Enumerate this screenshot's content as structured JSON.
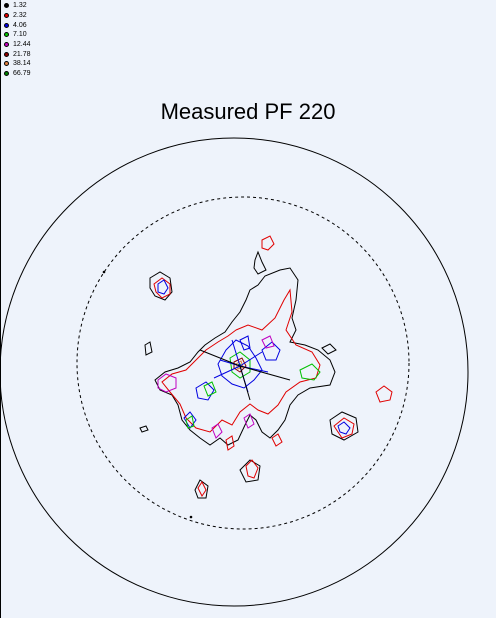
{
  "title": "Measured PF 220",
  "legend": [
    {
      "value": "1.32",
      "color": "#000000"
    },
    {
      "value": "2.32",
      "color": "#e00000"
    },
    {
      "value": "4.06",
      "color": "#0000e0"
    },
    {
      "value": "7.10",
      "color": "#00c000"
    },
    {
      "value": "12.44",
      "color": "#c000c0"
    },
    {
      "value": "21.78",
      "color": "#8b0000"
    },
    {
      "value": "38.14",
      "color": "#e08040"
    },
    {
      "value": "66.79",
      "color": "#008000"
    }
  ],
  "colors": {
    "background": "#eef3fb",
    "outer_circle": "#000000",
    "inner_circle": "#000000"
  }
}
